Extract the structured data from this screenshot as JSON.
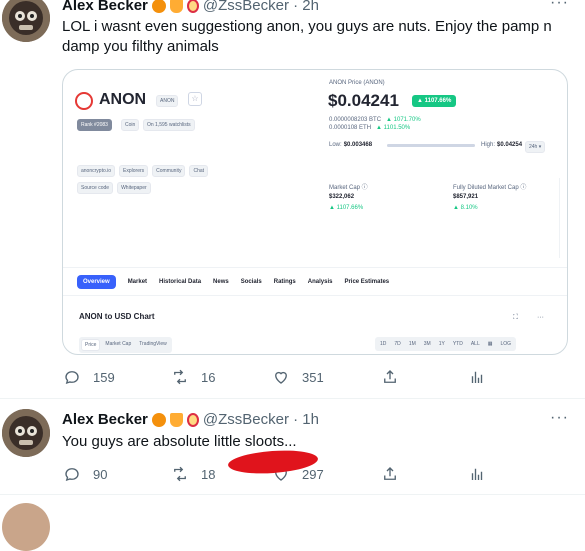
{
  "tweet1": {
    "author": "Alex Becker",
    "handle": "@ZssBecker · 2h",
    "text": "LOL i wasnt even suggestiong anon, you guys are nuts. Enjoy the pamp n damp you filthy animals",
    "more": "···",
    "replies": "159",
    "retweets": "16",
    "likes": "351"
  },
  "card": {
    "coin_name": "ANON",
    "ticker": "ANON",
    "rank": "Rank #2083",
    "type": "Coin",
    "watchlists": "On 1,595 watchlists",
    "price_label": "ANON Price (ANON)",
    "price": "$0.04241",
    "change": "▲ 1107.66%",
    "btc_price": "0.0000008203 BTC",
    "btc_change": "▲ 1071.70%",
    "eth_price": "0.0000108 ETH",
    "eth_change": "▲ 1101.50%",
    "low_label": "Low:",
    "low": "$0.003468",
    "high_label": "High:",
    "high": "$0.04254",
    "range": "24h ▾",
    "links": [
      "anoncrypto.io",
      "Explorers",
      "Community",
      "Chat"
    ],
    "links2": [
      "Source code",
      "Whitepaper"
    ],
    "market_cap_label": "Market Cap ⓘ",
    "market_cap": "$322,062",
    "market_cap_change": "▲ 1107.66%",
    "fdv_label": "Fully Diluted Market Cap ⓘ",
    "fdv": "$857,921",
    "fdv_change": "▲ 8.10%",
    "tabs": [
      "Overview",
      "Market",
      "Historical Data",
      "News",
      "Socials",
      "Ratings",
      "Analysis",
      "Price Estimates"
    ],
    "chart_title": "ANON to USD Chart",
    "chart_tabs": [
      "Price",
      "Market Cap",
      "TradingView"
    ],
    "time_ranges": [
      "1D",
      "7D",
      "1M",
      "3M",
      "1Y",
      "YTD",
      "ALL"
    ],
    "log": "LOG"
  },
  "tweet2": {
    "author": "Alex Becker",
    "handle": "@ZssBecker · 1h",
    "text": "You guys are absolute little sloots...",
    "more": "···",
    "replies": "90",
    "retweets": "18",
    "likes": "297"
  },
  "colors": {
    "green": "#16c784",
    "accent": "#3861fb",
    "redaction": "#e0141c"
  }
}
